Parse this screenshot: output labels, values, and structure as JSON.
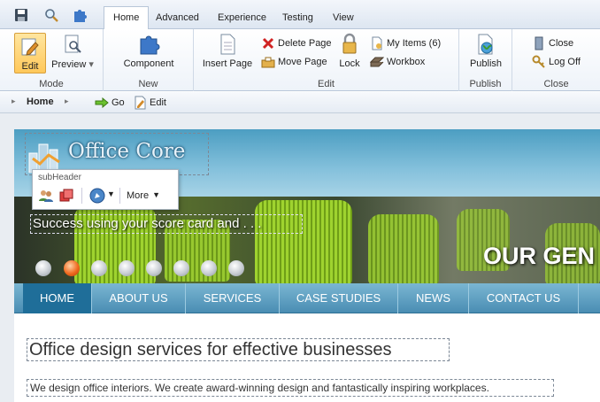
{
  "ribbon_tabs": [
    "Home",
    "Advanced",
    "Experience",
    "Testing",
    "View"
  ],
  "active_tab": "Home",
  "groups": {
    "mode": {
      "label": "Mode",
      "edit": "Edit",
      "preview": "Preview"
    },
    "new": {
      "label": "New",
      "component": "Component"
    },
    "edit": {
      "label": "Edit",
      "insert_page": "Insert Page",
      "delete_page": "Delete Page",
      "move_page": "Move Page",
      "lock": "Lock",
      "my_items": "My Items (6)",
      "workbox": "Workbox"
    },
    "publish": {
      "label": "Publish",
      "publish": "Publish"
    },
    "close": {
      "label": "Close",
      "close": "Close",
      "log_off": "Log Off"
    }
  },
  "breadcrumb": {
    "home": "Home",
    "go": "Go",
    "edit": "Edit"
  },
  "site": {
    "logo_text": "Office Core",
    "toolbar_title": "subHeader",
    "toolbar_more": "More",
    "banner_caption": "Success using your score card and . . .",
    "banner_headline": "OUR GEN",
    "nav": [
      "HOME",
      "ABOUT US",
      "SERVICES",
      "CASE STUDIES",
      "NEWS",
      "CONTACT US"
    ],
    "nav_active": "HOME",
    "heading": "Office design services for effective businesses",
    "body": "We design office interiors. We create award-winning design and fantastically inspiring workplaces."
  },
  "slider": {
    "count": 8,
    "active_index": 1
  },
  "colors": {
    "accent": "#1f6e99",
    "header": "#4c9ec2",
    "nav": "#4a8db3",
    "active_dot": "#f06a1f",
    "selected_button": "#ffc85a"
  }
}
